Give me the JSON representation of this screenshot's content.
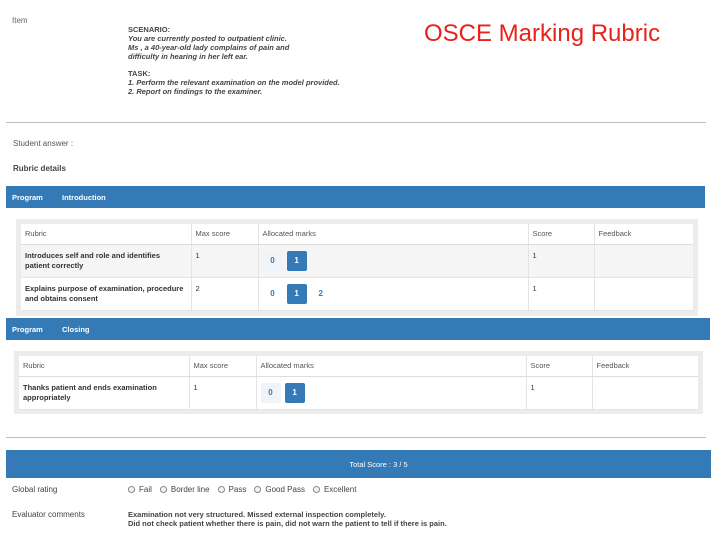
{
  "slide_title": "OSCE Marking Rubric",
  "item_label": "Item",
  "scenario": {
    "heading": "SCENARIO:",
    "line1": "You are currently posted to outpatient clinic.",
    "line2": "Ms                              , a 40-year-old lady complains of pain and",
    "line3": "difficulty in hearing in her left ear.",
    "task_heading": "TASK:",
    "task1": "1. Perform the relevant examination on the model provided.",
    "task2": "2. Report on findings to the examiner."
  },
  "student_answer_label": "Student answer :",
  "rubric_details_label": "Rubric details",
  "programs": [
    {
      "program_label": "Program",
      "program_name": "Introduction",
      "headers": [
        "Rubric",
        "Max score",
        "Allocated marks",
        "Score",
        "Feedback"
      ],
      "rows": [
        {
          "criterion": "Introduces self and role and identifies patient correctly",
          "max_score": "1",
          "marks": [
            "0",
            "1"
          ],
          "selected": "1",
          "score": "1",
          "feedback": ""
        },
        {
          "criterion": "Explains purpose of examination, procedure and obtains consent",
          "max_score": "2",
          "marks": [
            "0",
            "1",
            "2"
          ],
          "selected": "1",
          "score": "1",
          "feedback": ""
        }
      ]
    },
    {
      "program_label": "Program",
      "program_name": "Closing",
      "headers": [
        "Rubric",
        "Max score",
        "Allocated marks",
        "Score",
        "Feedback"
      ],
      "rows": [
        {
          "criterion": "Thanks patient and ends examination appropriately",
          "max_score": "1",
          "marks": [
            "0",
            "1"
          ],
          "selected": "1",
          "score": "1",
          "feedback": ""
        }
      ]
    }
  ],
  "total_score": "Total Score : 3 / 5",
  "global_rating": {
    "label": "Global rating",
    "options": [
      "Fail",
      "Border line",
      "Pass",
      "Good Pass",
      "Excellent"
    ]
  },
  "evaluator": {
    "label": "Evaluator comments",
    "line1": "Examination not very structured. Missed external inspection completely.",
    "line2": "Did not check patient whether there is pain, did not warn the patient to tell if there is pain."
  },
  "colors": {
    "primary": "#337ab7",
    "title_red": "#e8211b"
  }
}
